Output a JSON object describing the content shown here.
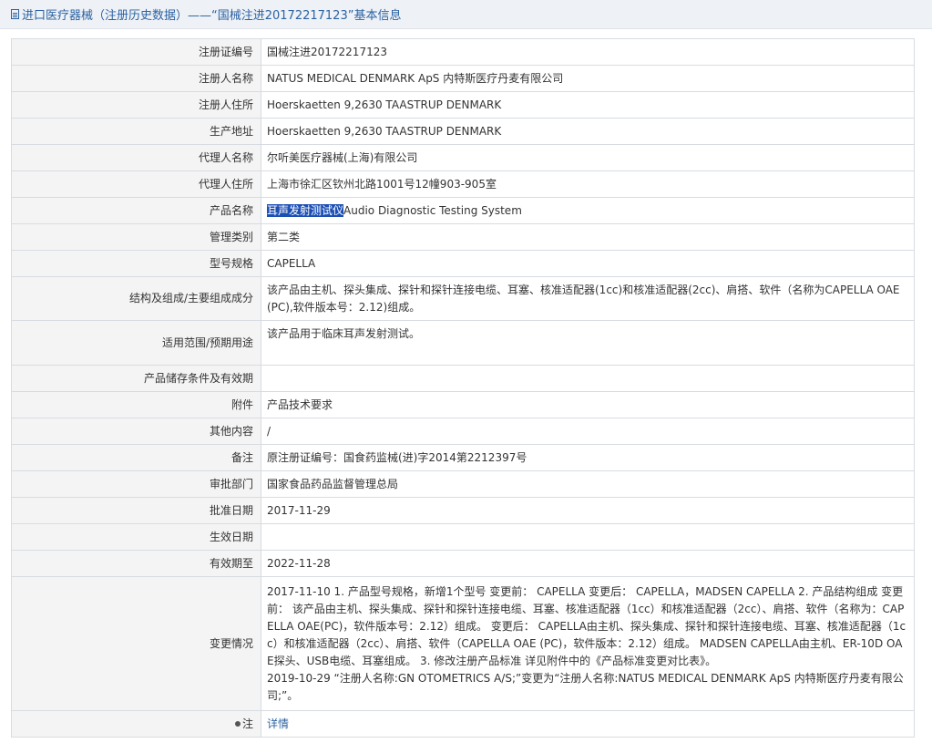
{
  "title": "进口医疗器械（注册历史数据）——“国械注进20172217123”基本信息",
  "rows": [
    {
      "label": "注册证编号",
      "value": "国械注进20172217123"
    },
    {
      "label": "注册人名称",
      "value": "NATUS MEDICAL DENMARK ApS 内特斯医疗丹麦有限公司"
    },
    {
      "label": "注册人住所",
      "value": "Hoerskaetten 9,2630 TAASTRUP DENMARK"
    },
    {
      "label": "生产地址",
      "value": "Hoerskaetten 9,2630 TAASTRUP DENMARK"
    },
    {
      "label": "代理人名称",
      "value": "尔听美医疗器械(上海)有限公司"
    },
    {
      "label": "代理人住所",
      "value": "上海市徐汇区钦州北路1001号12幢903-905室"
    },
    {
      "label": "产品名称",
      "value_highlight": "耳声发射测试仪",
      "value": "Audio Diagnostic Testing System"
    },
    {
      "label": "管理类别",
      "value": "第二类"
    },
    {
      "label": "型号规格",
      "value": "CAPELLA"
    },
    {
      "label": "结构及组成/主要组成成分",
      "value": "该产品由主机、探头集成、探针和探针连接电缆、耳塞、核准适配器(1cc)和核准适配器(2cc)、肩搭、软件（名称为CAPELLA OAE(PC),软件版本号：2.12)组成。"
    },
    {
      "label": "适用范围/预期用途",
      "value": "该产品用于临床耳声发射测试。"
    },
    {
      "label": "产品储存条件及有效期",
      "value": ""
    },
    {
      "label": "附件",
      "value": "产品技术要求"
    },
    {
      "label": "其他内容",
      "value": "/"
    },
    {
      "label": "备注",
      "value": "原注册证编号：国食药监械(进)字2014第2212397号"
    },
    {
      "label": "审批部门",
      "value": "国家食品药品监督管理总局"
    },
    {
      "label": "批准日期",
      "value": "2017-11-29"
    },
    {
      "label": "生效日期",
      "value": ""
    },
    {
      "label": "有效期至",
      "value": "2022-11-28"
    },
    {
      "label": "变更情况",
      "lines": [
        "2017-11-10 1. 产品型号规格，新增1个型号 变更前： CAPELLA 变更后： CAPELLA，MADSEN CAPELLA 2. 产品结构组成 变更前： 该产品由主机、探头集成、探针和探针连接电缆、耳塞、核准适配器（1cc）和核准适配器（2cc）、肩搭、软件（名称为：CAPELLA OAE(PC)，软件版本号：2.12）组成。 变更后： CAPELLA由主机、探头集成、探针和探针连接电缆、耳塞、核准适配器（1cc）和核准适配器（2cc）、肩搭、软件（CAPELLA OAE (PC)，软件版本：2.12）组成。 MADSEN CAPELLA由主机、ER-10D OAE探头、USB电缆、耳塞组成。 3. 修改注册产品标准 详见附件中的《产品标准变更对比表》。",
        "2019-10-29 “注册人名称:GN OTOMETRICS A/S;”变更为“注册人名称:NATUS MEDICAL DENMARK ApS 内特斯医疗丹麦有限公司;”。"
      ]
    },
    {
      "label": "注",
      "value": "详情"
    }
  ]
}
